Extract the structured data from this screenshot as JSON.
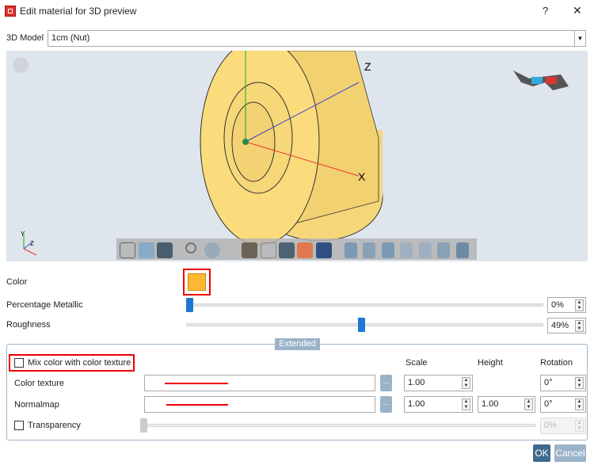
{
  "window": {
    "title": "Edit material for 3D preview",
    "help": "?",
    "close": "✕"
  },
  "model": {
    "label": "3D Model",
    "value": "1cm (Nut)"
  },
  "viewport": {
    "axis_z": "Z",
    "axis_x": "X",
    "mini_y": "Y",
    "mini_z": "Z"
  },
  "material": {
    "color_label": "Color",
    "color": "#FFB833",
    "metallic_label": "Percentage Metallic",
    "metallic_value": "0%",
    "metallic_pct": 0,
    "roughness_label": "Roughness",
    "roughness_value": "49%",
    "roughness_pct": 49
  },
  "extended": {
    "legend": "Extended",
    "mix_label": "Mix color with color texture",
    "headers": {
      "scale": "Scale",
      "height": "Height",
      "rotation": "Rotation"
    },
    "color_texture": {
      "label": "Color texture",
      "browse": "...",
      "scale": "1.00",
      "rotation": "0°"
    },
    "normalmap": {
      "label": "Normalmap",
      "browse": "...",
      "scale": "1.00",
      "height": "1.00",
      "rotation": "0°"
    },
    "transparency": {
      "label": "Transparency",
      "value": "0%",
      "pct": 0
    }
  },
  "buttons": {
    "ok": "OK",
    "cancel": "Cancel"
  }
}
